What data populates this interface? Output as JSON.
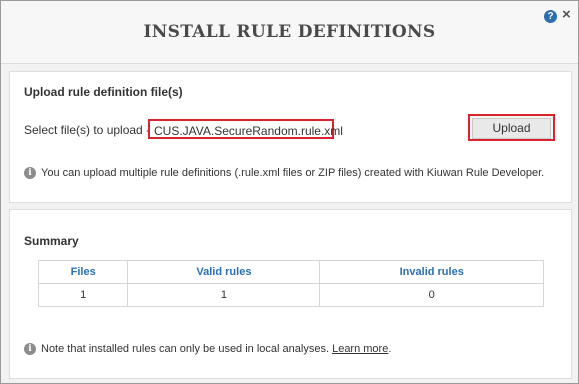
{
  "dialog": {
    "title": "INSTALL RULE DEFINITIONS",
    "help_glyph": "?",
    "close_glyph": "×"
  },
  "upload": {
    "section_title": "Upload rule definition file(s)",
    "select_label": "Select file(s) to upload -",
    "selected_file": "CUS.JAVA.SecureRandom.rule.xml",
    "upload_button_label": "Upload",
    "info_text": "You can upload multiple rule definitions (.rule.xml files or ZIP files) created with Kiuwan Rule Developer."
  },
  "summary": {
    "section_title": "Summary",
    "columns": [
      "Files",
      "Valid rules",
      "Invalid rules"
    ],
    "row": [
      "1",
      "1",
      "0"
    ],
    "note_text": "Note that installed rules can only be used in local analyses.",
    "learn_more_label": "Learn more",
    "note_end": "."
  },
  "icons": {
    "help": "help-icon",
    "close": "close-icon",
    "info": "info-icon"
  },
  "colors": {
    "highlight_border": "#d9232e",
    "header_link_blue": "#2b6fb0"
  }
}
